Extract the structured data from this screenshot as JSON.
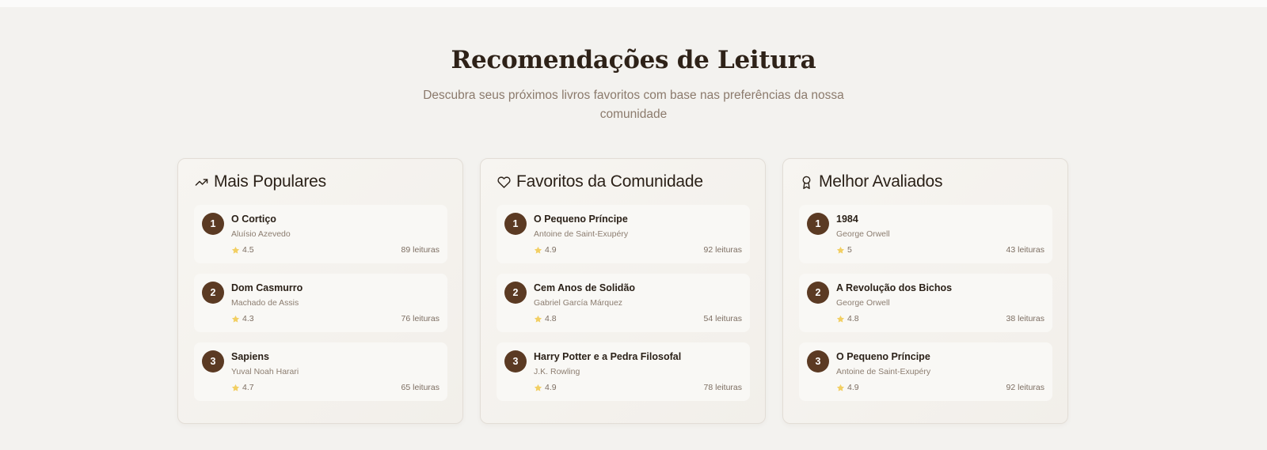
{
  "section": {
    "title": "Recomendações de Leitura",
    "subtitle": "Descubra seus próximos livros favoritos com base nas preferências da nossa comunidade"
  },
  "colors": {
    "accent": "#5b3a23",
    "star": "#f2cf63",
    "background": "#f3f2ef"
  },
  "cards": [
    {
      "title": "Mais Populares",
      "icon": "trending-up-icon",
      "books": [
        {
          "rank": "1",
          "title": "O Cortiço",
          "author": "Aluísio Azevedo",
          "rating": "4.5",
          "reads": "89 leituras"
        },
        {
          "rank": "2",
          "title": "Dom Casmurro",
          "author": "Machado de Assis",
          "rating": "4.3",
          "reads": "76 leituras"
        },
        {
          "rank": "3",
          "title": "Sapiens",
          "author": "Yuval Noah Harari",
          "rating": "4.7",
          "reads": "65 leituras"
        }
      ]
    },
    {
      "title": "Favoritos da Comunidade",
      "icon": "heart-icon",
      "books": [
        {
          "rank": "1",
          "title": "O Pequeno Príncipe",
          "author": "Antoine de Saint-Exupéry",
          "rating": "4.9",
          "reads": "92 leituras"
        },
        {
          "rank": "2",
          "title": "Cem Anos de Solidão",
          "author": "Gabriel García Márquez",
          "rating": "4.8",
          "reads": "54 leituras"
        },
        {
          "rank": "3",
          "title": "Harry Potter e a Pedra Filosofal",
          "author": "J.K. Rowling",
          "rating": "4.9",
          "reads": "78 leituras"
        }
      ]
    },
    {
      "title": "Melhor Avaliados",
      "icon": "award-icon",
      "books": [
        {
          "rank": "1",
          "title": "1984",
          "author": "George Orwell",
          "rating": "5",
          "reads": "43 leituras"
        },
        {
          "rank": "2",
          "title": "A Revolução dos Bichos",
          "author": "George Orwell",
          "rating": "4.8",
          "reads": "38 leituras"
        },
        {
          "rank": "3",
          "title": "O Pequeno Príncipe",
          "author": "Antoine de Saint-Exupéry",
          "rating": "4.9",
          "reads": "92 leituras"
        }
      ]
    }
  ]
}
